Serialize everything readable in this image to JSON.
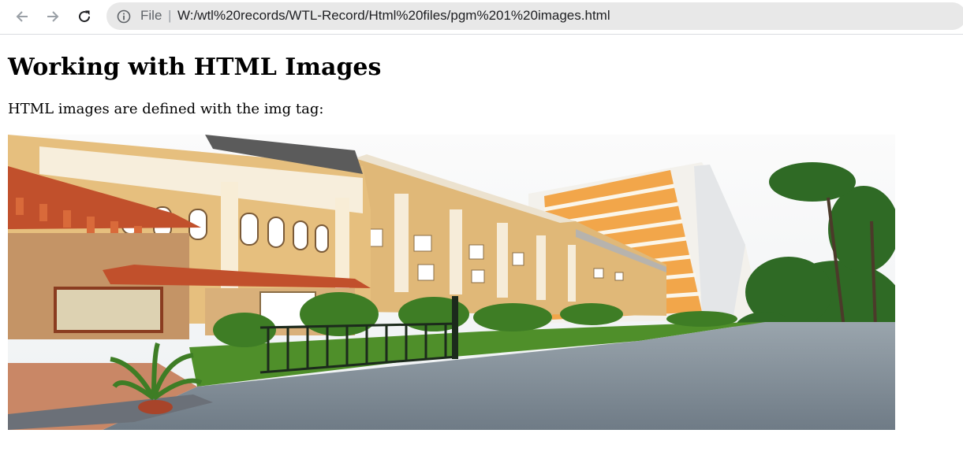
{
  "browser": {
    "scheme_label": "File",
    "separator": "|",
    "url": "W:/wtl%20records/WTL-Record/Html%20files/pgm%201%20images.html",
    "icons": [
      "back-arrow-icon",
      "forward-arrow-icon",
      "reload-icon",
      "info-icon"
    ]
  },
  "page": {
    "heading": "Working with HTML Images",
    "paragraph": "HTML images are defined with the img tag:"
  },
  "colors": {
    "toolbar_bg": "#ffffff",
    "omnibox_bg": "#e8e8e8",
    "building_wall": "#e6bf7e",
    "roof_tile": "#c1502c",
    "tower_orange": "#f2a64a",
    "lawn": "#4f8f2a",
    "road": "#7d8994"
  }
}
